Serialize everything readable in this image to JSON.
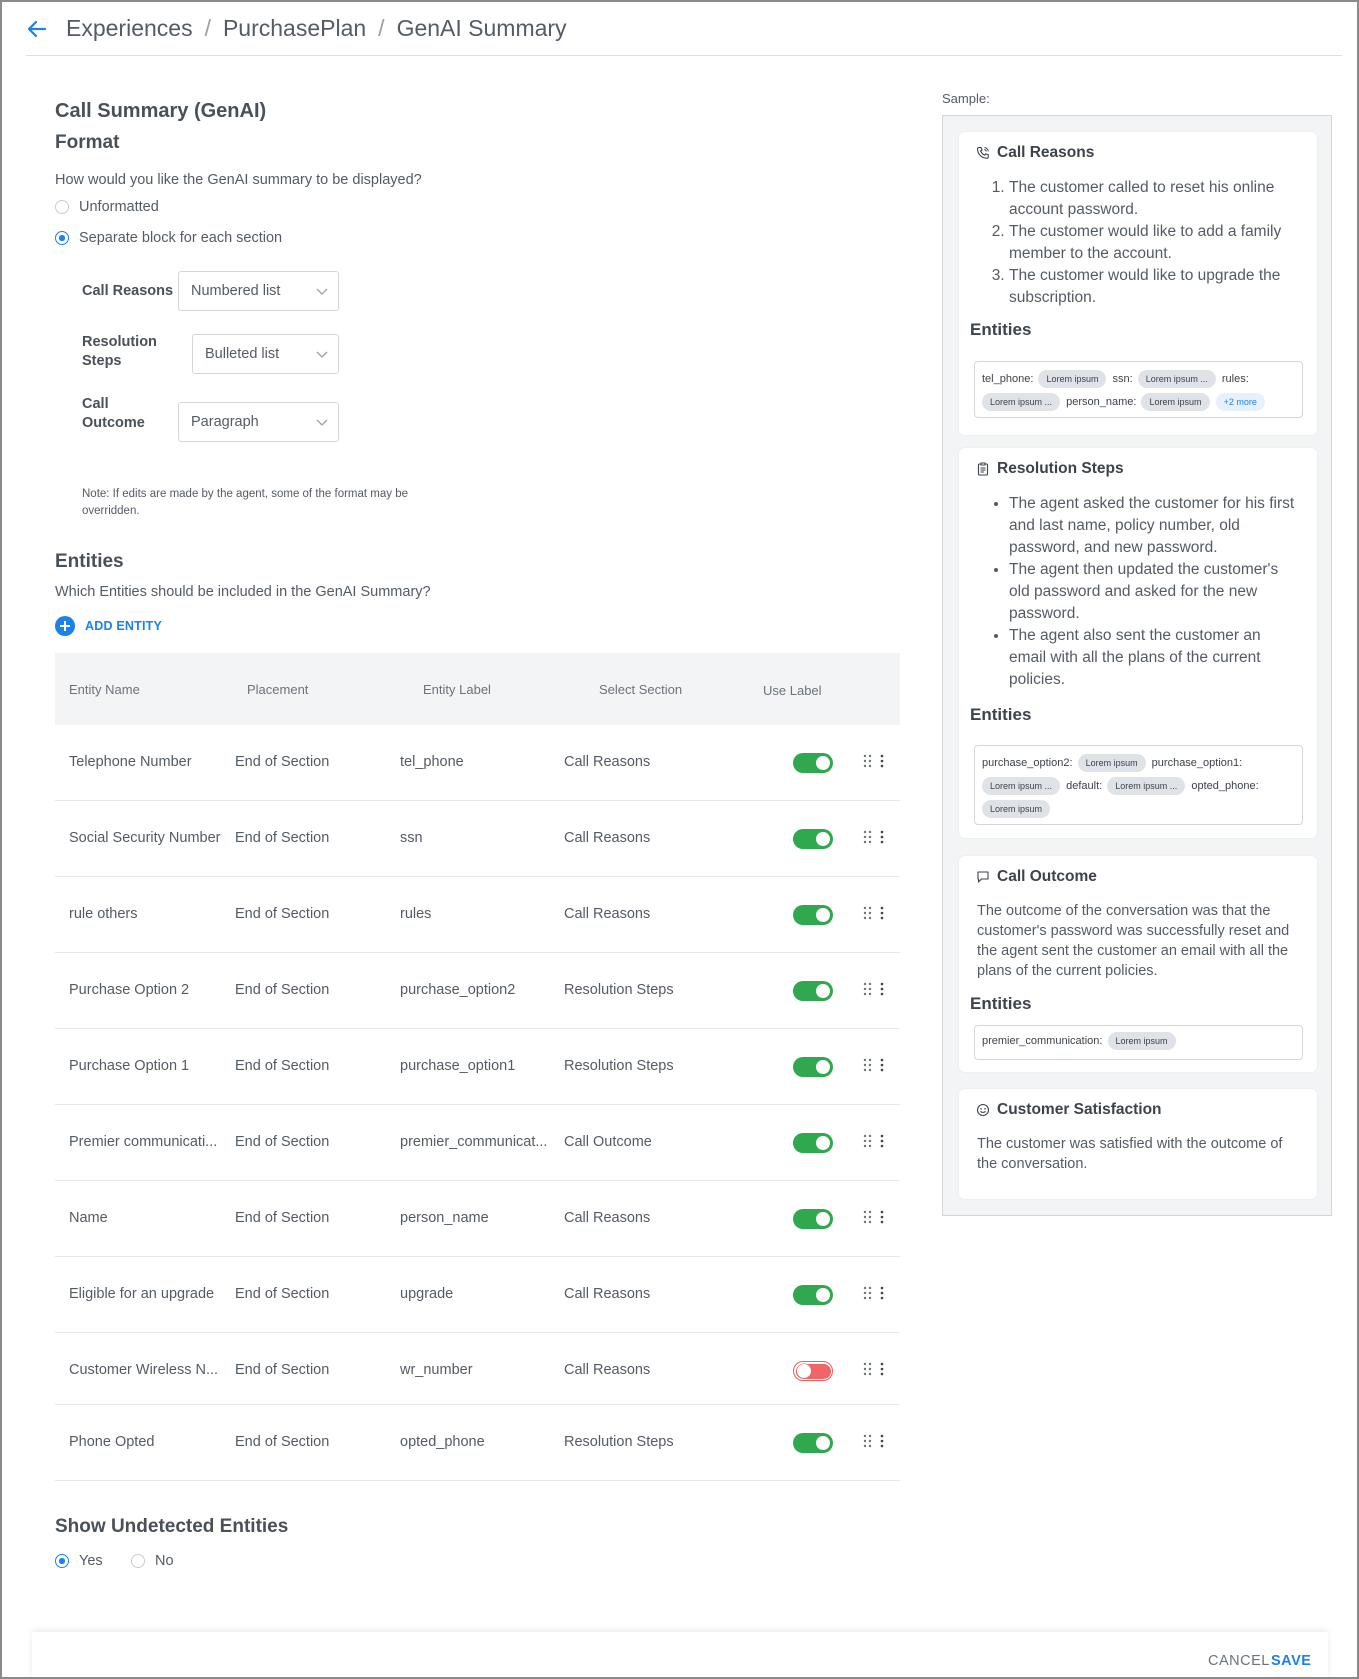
{
  "breadcrumb": [
    "Experiences",
    "PurchasePlan",
    "GenAI Summary"
  ],
  "page_title": "Call Summary (GenAI)",
  "format": {
    "heading": "Format",
    "question": "How would you like the GenAI summary to be displayed?",
    "options": [
      {
        "label": "Unformatted",
        "selected": false
      },
      {
        "label": "Separate block for each section",
        "selected": true
      }
    ],
    "sections": [
      {
        "label_line1": "Call Reasons",
        "label_line2": "",
        "value": "Numbered list"
      },
      {
        "label_line1": "Resolution",
        "label_line2": "Steps",
        "value": "Bulleted list"
      },
      {
        "label_line1": "Call",
        "label_line2": "Outcome",
        "value": "Paragraph"
      }
    ],
    "note_line1": "Note: If edits are made by the agent, some of the format may be",
    "note_line2": "overridden."
  },
  "entities": {
    "heading": "Entities",
    "question": "Which Entities should be included in the GenAI Summary?",
    "add_label": "ADD ENTITY",
    "columns": [
      "Entity Name",
      "Placement",
      "Entity Label",
      "Select Section",
      "Use Label"
    ],
    "rows": [
      {
        "name": "Telephone Number",
        "placement": "End of Section",
        "label": "tel_phone",
        "section": "Call Reasons",
        "use_label": true
      },
      {
        "name": "Social Security Number",
        "placement": "End of Section",
        "label": "ssn",
        "section": "Call Reasons",
        "use_label": true
      },
      {
        "name": "rule others",
        "placement": "End of Section",
        "label": "rules",
        "section": "Call Reasons",
        "use_label": true
      },
      {
        "name": "Purchase Option 2",
        "placement": "End of Section",
        "label": "purchase_option2",
        "section": "Resolution Steps",
        "use_label": true
      },
      {
        "name": "Purchase Option 1",
        "placement": "End of Section",
        "label": "purchase_option1",
        "section": "Resolution Steps",
        "use_label": true
      },
      {
        "name": "Premier communicati...",
        "placement": "End of Section",
        "label": "premier_communicat...",
        "section": "Call Outcome",
        "use_label": true
      },
      {
        "name": "Name",
        "placement": "End of Section",
        "label": "person_name",
        "section": "Call Reasons",
        "use_label": true
      },
      {
        "name": "Eligible for an upgrade",
        "placement": "End of Section",
        "label": "upgrade",
        "section": "Call Reasons",
        "use_label": true
      },
      {
        "name": "Customer Wireless N...",
        "placement": "End of Section",
        "label": "wr_number",
        "section": "Call Reasons",
        "use_label": false
      },
      {
        "name": "Phone Opted",
        "placement": "End of Section",
        "label": "opted_phone",
        "section": "Resolution Steps",
        "use_label": true
      }
    ]
  },
  "undetected": {
    "heading": "Show Undetected Entities",
    "options": [
      {
        "label": "Yes",
        "selected": true
      },
      {
        "label": "No",
        "selected": false
      }
    ]
  },
  "sample": {
    "label": "Sample:",
    "entities_heading": "Entities",
    "call_reasons": {
      "title": "Call Reasons",
      "icon": "phone-icon",
      "items": [
        "The customer called to reset his online account password.",
        "The customer would like to add a family member to the account.",
        "The customer would like to upgrade the subscription."
      ],
      "entity_keys": [
        "tel_phone:",
        "ssn:",
        "rules:",
        "person_name:"
      ],
      "entity_chips": [
        "Lorem ipsum",
        "Lorem ipsum ...",
        "Lorem ipsum ...",
        "Lorem ipsum"
      ],
      "more": "+2 more"
    },
    "resolution_steps": {
      "title": "Resolution Steps",
      "icon": "clipboard-icon",
      "items": [
        "The agent asked the customer for his first and last name, policy number, old password, and new password.",
        "The agent then updated the customer's old password and asked for the new password.",
        "The agent also sent the customer an email with all the plans of the current policies."
      ],
      "entity_keys": [
        "purchase_option2:",
        "purchase_option1:",
        "default:",
        "opted_phone:"
      ],
      "entity_chips": [
        "Lorem ipsum",
        "Lorem ipsum ...",
        "Lorem ipsum ...",
        "Lorem ipsum"
      ]
    },
    "call_outcome": {
      "title": "Call Outcome",
      "icon": "chat-icon",
      "text": "The outcome of the conversation was that the customer's password was successfully reset and the agent sent the customer an email with all the plans of the current policies.",
      "entity_key": "premier_communication:",
      "entity_chip": "Lorem ipsum"
    },
    "customer_satisfaction": {
      "title": "Customer Satisfaction",
      "icon": "smile-icon",
      "text": "The customer was satisfied with the outcome of the conversation."
    }
  },
  "footer": {
    "cancel": "CANCEL",
    "save": "SAVE"
  },
  "colors": {
    "accent": "#1a82e8",
    "toggle_on": "#2fa84f",
    "toggle_off": "#f06565"
  }
}
